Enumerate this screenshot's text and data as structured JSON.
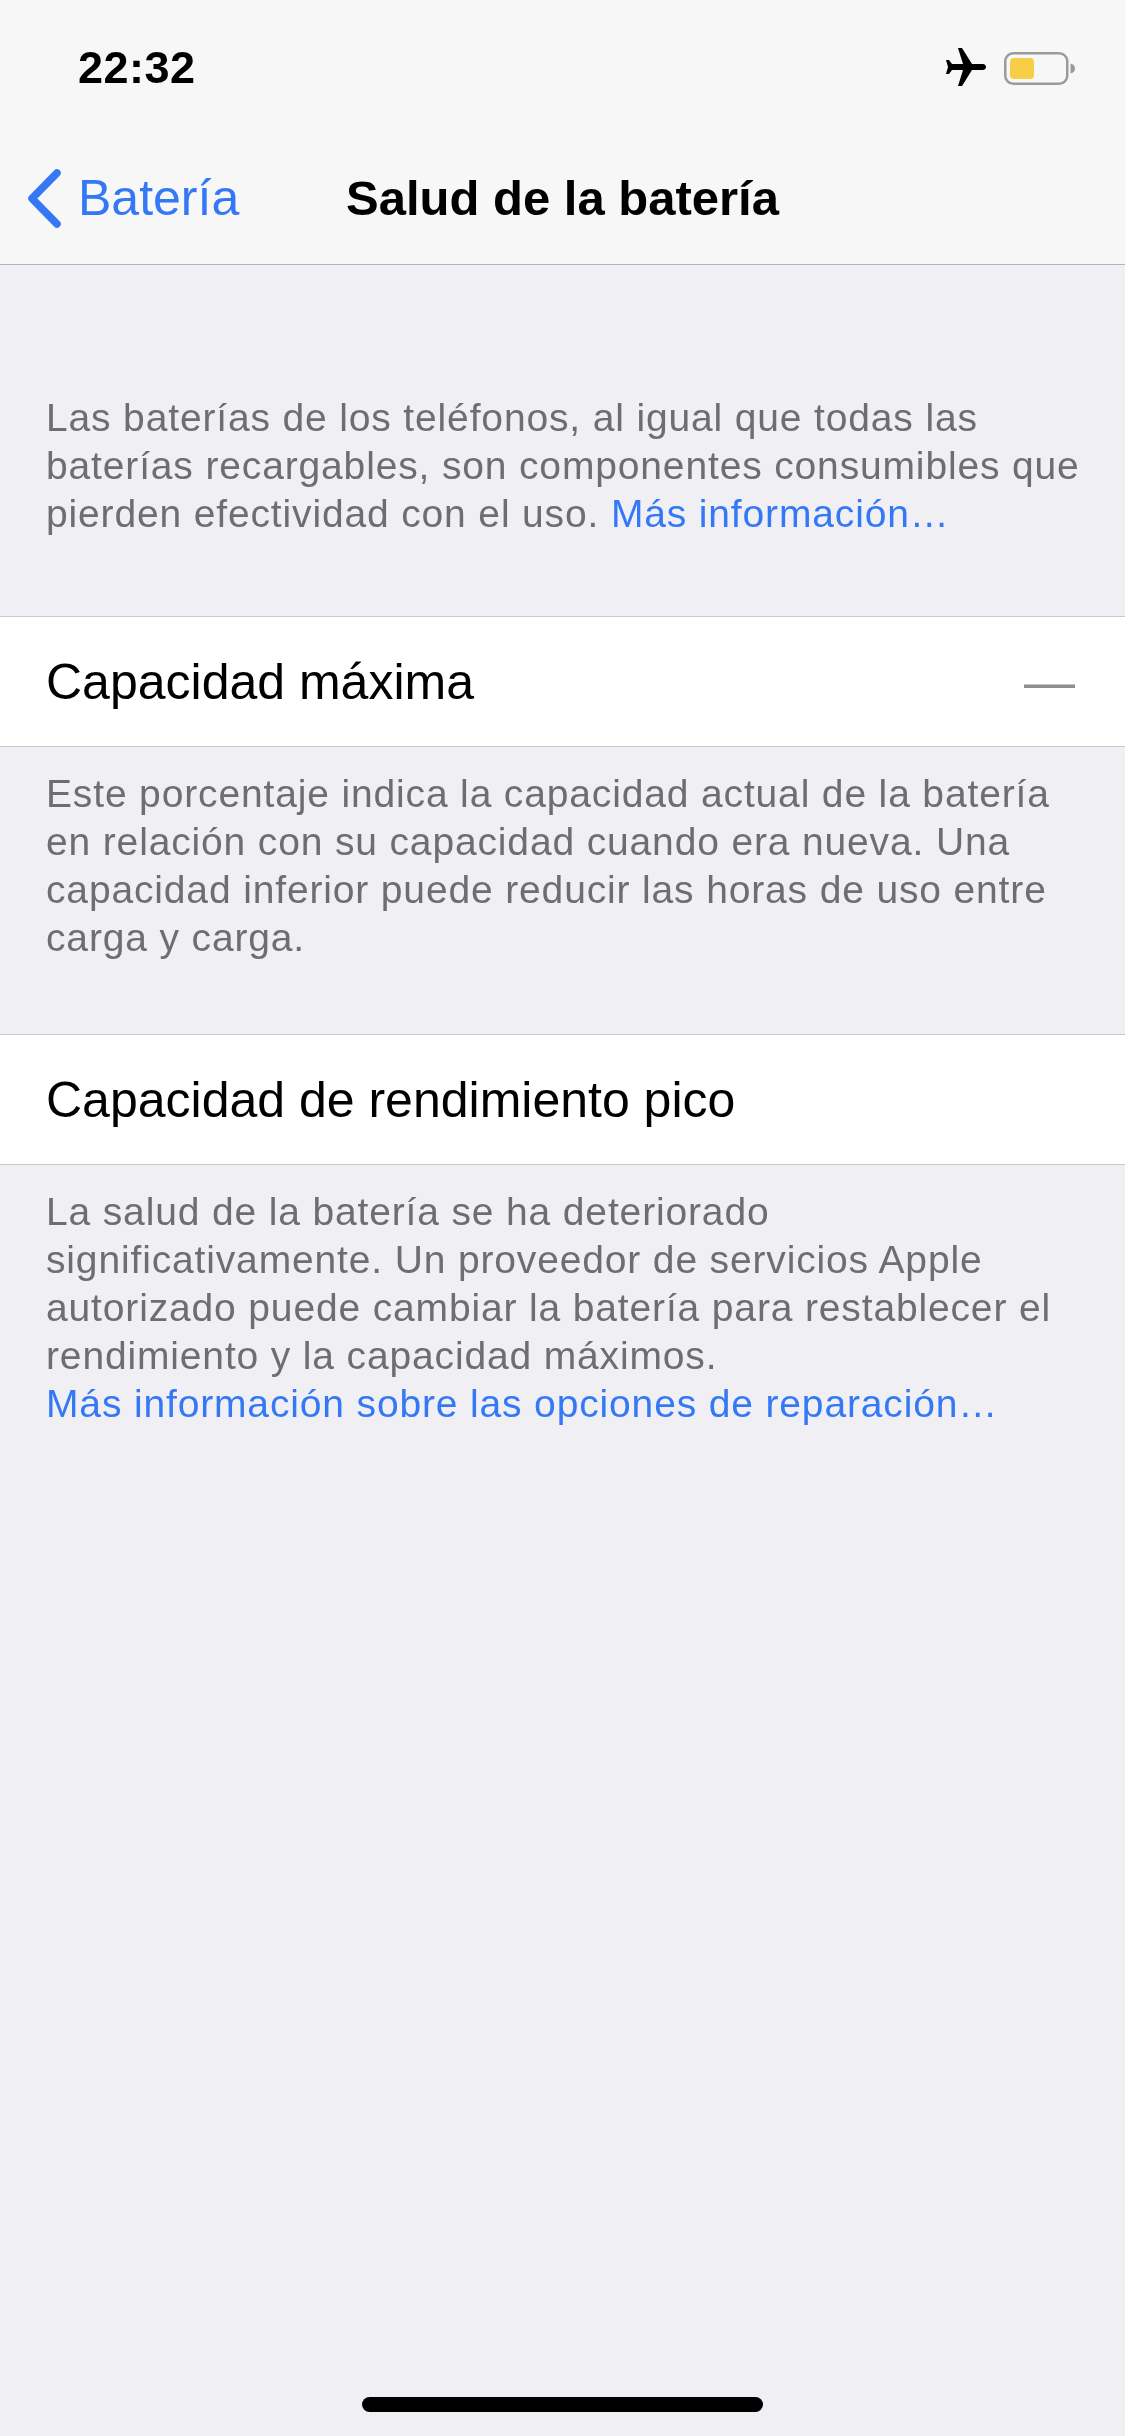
{
  "status_bar": {
    "time": "22:32"
  },
  "nav_bar": {
    "back_label": "Batería",
    "title": "Salud de la batería"
  },
  "intro": {
    "text": "Las baterías de los teléfonos, al igual que todas las baterías recargables, son componentes consumibles que pierden efectividad con el uso.",
    "link": "Más información…"
  },
  "groups": [
    {
      "label": "Capacidad máxima",
      "value": "—",
      "footer": "Este porcentaje indica la capacidad actual de la batería en relación con su capacidad cuando era nueva. Una capacidad inferior puede reducir las horas de uso entre carga y carga."
    },
    {
      "label": "Capacidad de rendimiento pico",
      "footer": "La salud de la batería se ha deteriorado significativamente. Un proveedor de servicios Apple autorizado puede cambiar la batería para restablecer el rendimiento y la capacidad máximos.",
      "footer_link": "Más información sobre las opciones de reparación…"
    }
  ]
}
